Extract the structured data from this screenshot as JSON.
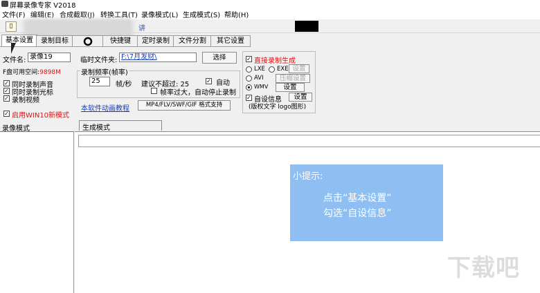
{
  "window": {
    "title": "屏幕录像专家 V2018"
  },
  "menu": [
    "文件(F)",
    "编辑(E)",
    "合成截取(J)",
    "转换工具(T)",
    "录像模式(L)",
    "生成模式(S)",
    "帮助(H)"
  ],
  "toolbar": {
    "new_icon": "document-icon",
    "ghost_text": "讲"
  },
  "tabs": [
    "基本设置",
    "录制目标",
    "",
    "快捷键",
    "定时录制",
    "文件分割",
    "其它设置"
  ],
  "basic": {
    "filename_label": "文件名:",
    "filename_value": "录像19",
    "tempdir_label": "临时文件夹:",
    "tempdir_value": "F:\\7月发财\\",
    "browse_button": "选择",
    "free_space_label": "F盘可用空间:",
    "free_space_value": "9898M",
    "record_audio": "同时录制声音",
    "record_cursor": "同时录制光标",
    "record_video": "录制视频",
    "win10_mode": "启用WIN10新模式",
    "fps_group": "录制频率(帧率)",
    "fps_value": "25",
    "fps_unit": "帧/秒",
    "fps_suggest": "建议不超过: 25",
    "auto_label": "自动",
    "fps_too_high": "帧率过大，自动停止录制",
    "tutorial_link": "本软件动画教程",
    "formats_button": "MP4/FLV/SWF/GIF  格式支持"
  },
  "generate": {
    "direct": "直接录制生成",
    "lxe": "LXE",
    "exe": "EXE",
    "settings1": "设置",
    "avi": "AVI",
    "compress": "压缩设置",
    "wmv": "WMV",
    "settings2": "设置",
    "custom_info": "自设信息",
    "settings3": "设置",
    "custom_info_note": "(版权文字 logo图形)"
  },
  "panels": {
    "left_header": "录像模式",
    "right_header": "生成模式"
  },
  "tip": {
    "title": "小提示:",
    "line1": "点击“基本设置”",
    "line2": "勾选“自设信息”"
  },
  "watermark": "下载吧",
  "colors": {
    "tip_bg": "#8fbff2",
    "red_text": "#e01010",
    "link": "#1a3fb0"
  }
}
